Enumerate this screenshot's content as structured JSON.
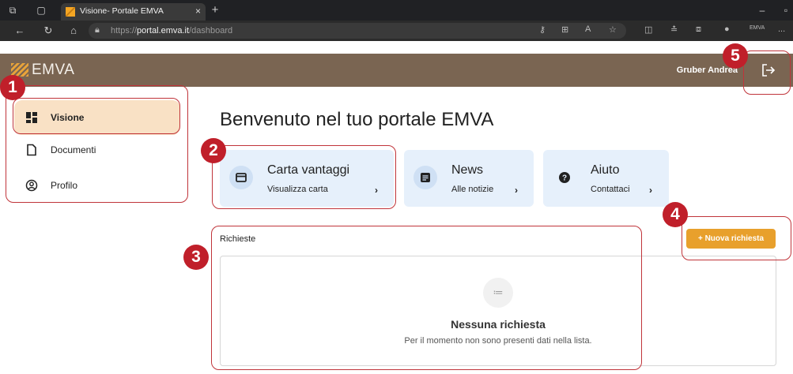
{
  "browser": {
    "tab_title": "Visione- Portale EMVA",
    "tab_close": "×",
    "new_tab": "+",
    "url_prefix": "https://",
    "url_host": "portal.emva.it",
    "url_path": "/dashboard",
    "toolbar_small_text": "EMVA",
    "more": "...",
    "minimize": "–"
  },
  "header": {
    "logo_text": "EMVA",
    "user_name": "Gruber Andrea",
    "colors": {
      "bar": "#7a6552",
      "accent": "#e8a33a"
    }
  },
  "sidebar": {
    "items": [
      {
        "label": "Visione",
        "icon": "dashboard-icon",
        "active": true
      },
      {
        "label": "Documenti",
        "icon": "document-icon",
        "active": false
      },
      {
        "label": "Profilo",
        "icon": "profile-icon",
        "active": false
      }
    ]
  },
  "main": {
    "welcome": "Benvenuto nel tuo portale EMVA",
    "cards": [
      {
        "title": "Carta vantaggi",
        "subtitle": "Visualizza carta",
        "icon": "card-icon"
      },
      {
        "title": "News",
        "subtitle": "Alle notizie",
        "icon": "news-icon"
      },
      {
        "title": "Aiuto",
        "subtitle": "Contattaci",
        "icon": "help-icon"
      }
    ],
    "requests": {
      "label": "Richieste",
      "new_button": "+ Nuova richiesta",
      "empty_title": "Nessuna richiesta",
      "empty_subtitle": "Per il momento non sono presenti dati nella lista."
    }
  },
  "annotations": {
    "badges": [
      "1",
      "2",
      "3",
      "4",
      "5"
    ],
    "color": "#c01f2a"
  }
}
